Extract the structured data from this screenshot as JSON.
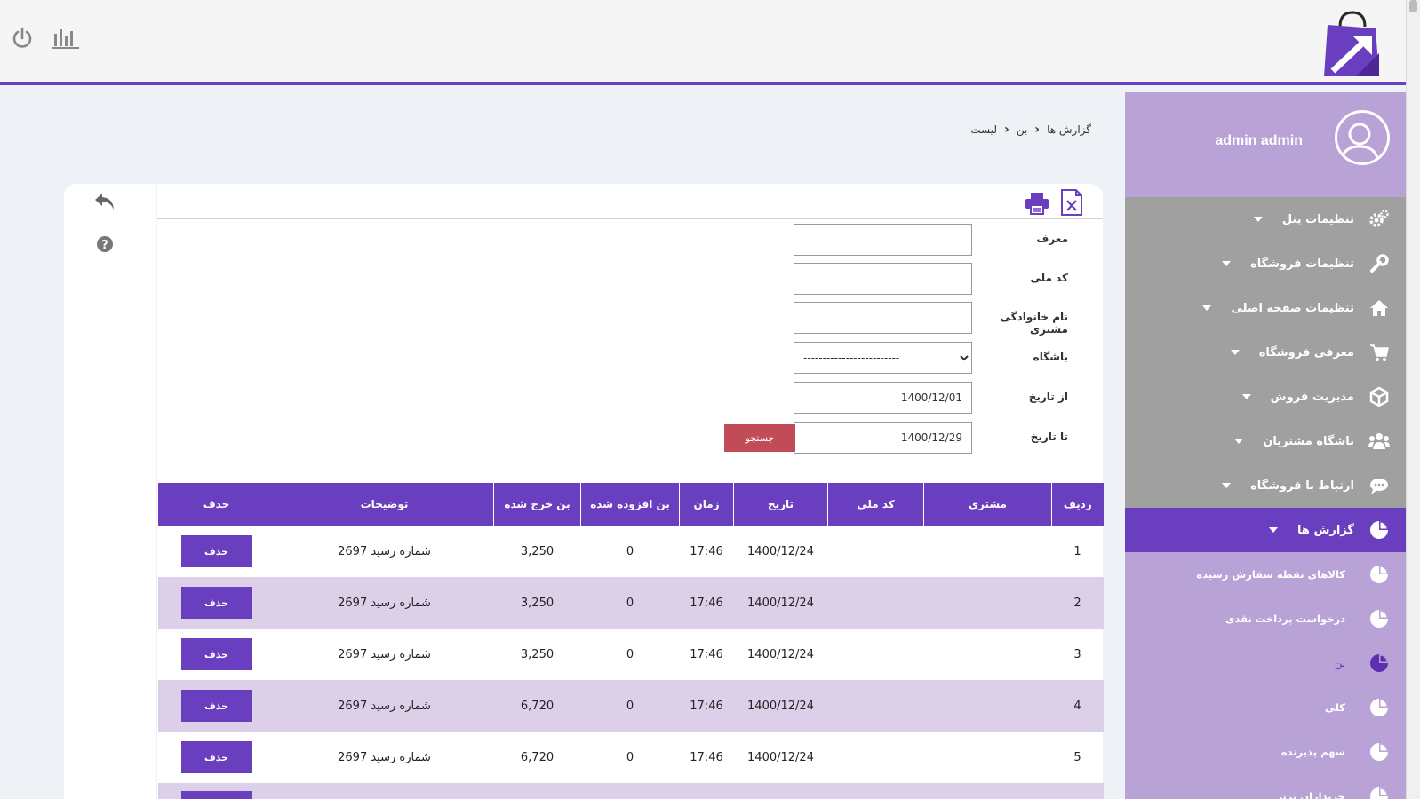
{
  "header": {
    "power_icon": "power-icon",
    "stats_icon": "bar-chart-icon",
    "logo_icon": "shopping-bag-logo"
  },
  "sidebar": {
    "username": "admin admin",
    "menu": [
      {
        "label": "تنظیمات پنل",
        "icon": "gears-icon"
      },
      {
        "label": "تنظیمات فروشگاه",
        "icon": "wrench-icon"
      },
      {
        "label": "تنظیمات صفحه اصلی",
        "icon": "home-icon"
      },
      {
        "label": "معرفی فروشگاه",
        "icon": "cart-icon"
      },
      {
        "label": "مدیریت فروش",
        "icon": "box-icon"
      },
      {
        "label": "باشگاه مشتریان",
        "icon": "users-icon"
      },
      {
        "label": "ارتباط با فروشگاه",
        "icon": "chat-icon"
      },
      {
        "label": "گزارش ها",
        "icon": "pie-chart-icon"
      }
    ],
    "submenu": [
      {
        "label": "کالاهای نقطه سفارش رسیده"
      },
      {
        "label": "درخواست پرداخت نقدی"
      },
      {
        "label": "بن"
      },
      {
        "label": "کلی"
      },
      {
        "label": "سهم پذیرنده"
      },
      {
        "label": "خریداران برتر"
      }
    ]
  },
  "breadcrumb": {
    "items": [
      "گزارش ها",
      "بن",
      "لیست"
    ]
  },
  "form": {
    "referrer_label": "معرف",
    "national_code_label": "کد ملی",
    "family_name_label": "نام خانوادگی مشتری",
    "club_label": "باشگاه",
    "club_selected": "-------------------------",
    "from_date_label": "از تاریخ",
    "from_date_value": "1400/12/01",
    "to_date_label": "تا تاریخ",
    "to_date_value": "1400/12/29",
    "search_label": "جستجو"
  },
  "table": {
    "headers": [
      "ردیف",
      "مشتری",
      "کد ملی",
      "تاریخ",
      "زمان",
      "بن افزوده شده",
      "بن خرج شده",
      "توضیحات",
      "حذف"
    ],
    "delete_label": "حذف",
    "rows": [
      {
        "row": "1",
        "customer": "",
        "national_code": "",
        "date": "1400/12/24",
        "time": "17:46",
        "added": "0",
        "spent": "3,250",
        "desc": "شماره رسید 2697"
      },
      {
        "row": "2",
        "customer": "",
        "national_code": "",
        "date": "1400/12/24",
        "time": "17:46",
        "added": "0",
        "spent": "3,250",
        "desc": "شماره رسید 2697"
      },
      {
        "row": "3",
        "customer": "",
        "national_code": "",
        "date": "1400/12/24",
        "time": "17:46",
        "added": "0",
        "spent": "3,250",
        "desc": "شماره رسید 2697"
      },
      {
        "row": "4",
        "customer": "",
        "national_code": "",
        "date": "1400/12/24",
        "time": "17:46",
        "added": "0",
        "spent": "6,720",
        "desc": "شماره رسید 2697"
      },
      {
        "row": "5",
        "customer": "",
        "national_code": "",
        "date": "1400/12/24",
        "time": "17:46",
        "added": "0",
        "spent": "6,720",
        "desc": "شماره رسید 2697"
      },
      {
        "row": "",
        "customer": "",
        "national_code": "",
        "date": "",
        "time": "",
        "added": "",
        "spent": "",
        "desc": ""
      }
    ]
  },
  "colors": {
    "accent": "#6a3fbf",
    "sidebar": "#b9a2d6",
    "menu_bg": "#a0a0a0",
    "row_alt": "#dcd0e8",
    "search_button": "#c14c57"
  }
}
